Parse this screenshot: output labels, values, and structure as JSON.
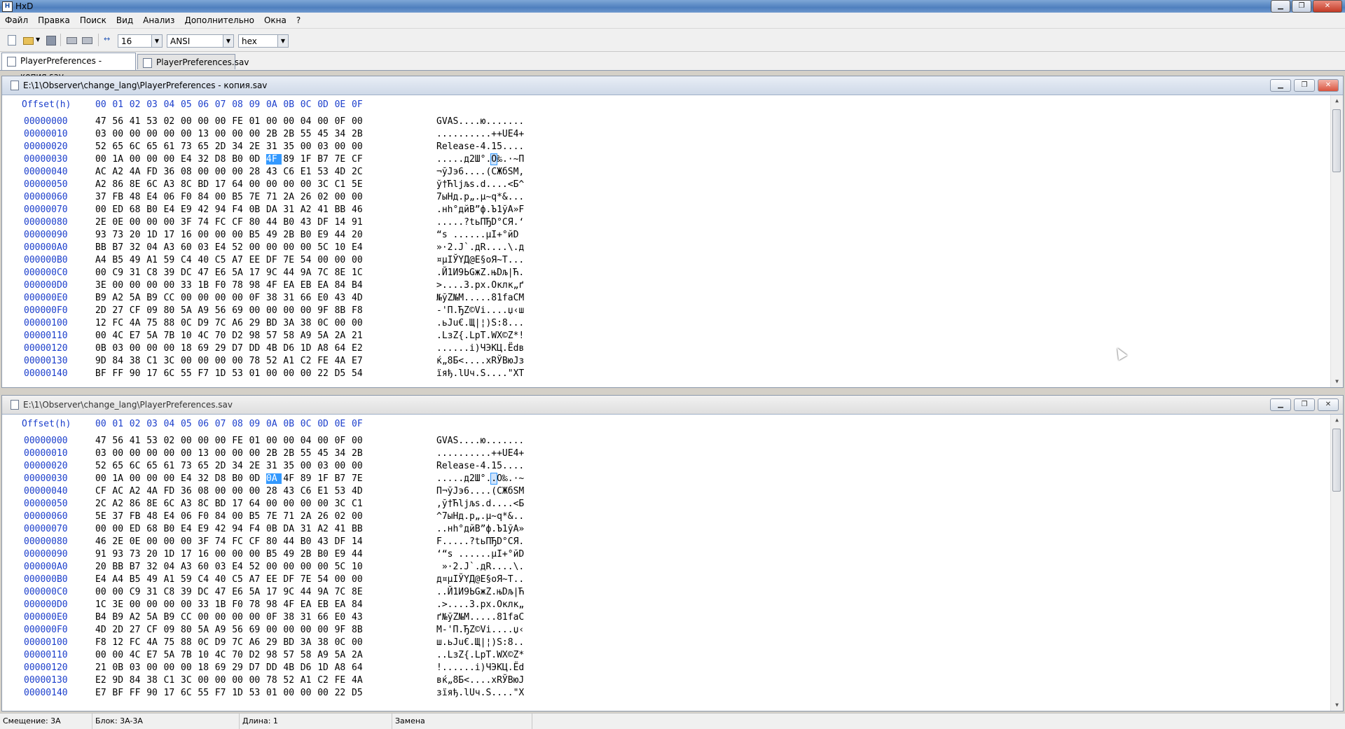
{
  "app": {
    "title": "HxD"
  },
  "menu": [
    "Файл",
    "Правка",
    "Поиск",
    "Вид",
    "Анализ",
    "Дополнительно",
    "Окна",
    "?"
  ],
  "toolbar": {
    "bytes_per_row": "16",
    "charset": "ANSI",
    "display_mode": "hex"
  },
  "tabs": [
    {
      "label": "PlayerPreferences - копия.sav",
      "active": true
    },
    {
      "label": "PlayerPreferences.sav",
      "active": false
    }
  ],
  "header": {
    "offset_label": "Offset(h)",
    "columns": [
      "00",
      "01",
      "02",
      "03",
      "04",
      "05",
      "06",
      "07",
      "08",
      "09",
      "0A",
      "0B",
      "0C",
      "0D",
      "0E",
      "0F"
    ]
  },
  "editors": [
    {
      "path": "E:\\1\\Observer\\change_lang\\PlayerPreferences - копия.sav",
      "selected": {
        "row": 3,
        "col": 10
      },
      "rows": [
        {
          "off": "00000000",
          "bytes": "47 56 41 53 02 00 00 00 FE 01 00 00 04 00 0F 00",
          "ascii": "GVAS....ю......."
        },
        {
          "off": "00000010",
          "bytes": "03 00 00 00 00 00 13 00 00 00 2B 2B 55 45 34 2B",
          "ascii": "..........++UE4+"
        },
        {
          "off": "00000020",
          "bytes": "52 65 6C 65 61 73 65 2D 34 2E 31 35 00 03 00 00",
          "ascii": "Release-4.15...."
        },
        {
          "off": "00000030",
          "bytes": "00 1A 00 00 00 E4 32 D8 B0 0D 4F 89 1F B7 7E CF",
          "ascii": ".....д2Ш°.O‰.·~П"
        },
        {
          "off": "00000040",
          "bytes": "AC A2 4A FD 36 08 00 00 00 28 43 C6 E1 53 4D 2C",
          "ascii": "¬ўJэ6....(CЖбSM,"
        },
        {
          "off": "00000050",
          "bytes": "A2 86 8E 6C A3 8C BD 17 64 00 00 00 00 3C C1 5E",
          "ascii": "ў†Ћlјљѕ.d....<Б^"
        },
        {
          "off": "00000060",
          "bytes": "37 FB 48 E4 06 F0 84 00 B5 7E 71 2A 26 02 00 00",
          "ascii": "7ыНд.р„.µ~q*&..."
        },
        {
          "off": "00000070",
          "bytes": "00 ED 68 B0 E4 E9 42 94 F4 0B DA 31 A2 41 BB 46",
          "ascii": ".нh°дйВ”ф.Ъ1ўA»F"
        },
        {
          "off": "00000080",
          "bytes": "2E 0E 00 00 00 3F 74 FC CF 80 44 B0 43 DF 14 91",
          "ascii": ".....?tьПЂD°CЯ.‘"
        },
        {
          "off": "00000090",
          "bytes": "93 73 20 1D 17 16 00 00 00 B5 49 2B B0 E9 44 20",
          "ascii": "“s ......µI+°йD "
        },
        {
          "off": "000000A0",
          "bytes": "BB B7 32 04 A3 60 03 E4 52 00 00 00 00 5C 10 E4",
          "ascii": "»·2.J`.дR....\\.д"
        },
        {
          "off": "000000B0",
          "bytes": "A4 B5 49 A1 59 C4 40 C5 A7 EE DF 7E 54 00 00 00",
          "ascii": "¤µIЎYД@Е§оЯ~T..."
        },
        {
          "off": "000000C0",
          "bytes": "00 C9 31 C8 39 DC 47 E6 5A 17 9C 44 9A 7C 8E 1C",
          "ascii": ".Й1И9ЬGжZ.њDљ|Ћ."
        },
        {
          "off": "000000D0",
          "bytes": "3E 00 00 00 00 33 1B F0 78 98 4F EA EB EA 84 B4",
          "ascii": ">....3.рх.Оклк„ґ"
        },
        {
          "off": "000000E0",
          "bytes": "B9 A2 5A B9 CC 00 00 00 00 0F 38 31 66 E0 43 4D",
          "ascii": "№ўZ№М.....81faCM"
        },
        {
          "off": "000000F0",
          "bytes": "2D 27 CF 09 80 5A A9 56 69 00 00 00 00 9F 8B F8",
          "ascii": "-'П.ЂZ©Vi....џ‹ш"
        },
        {
          "off": "00000100",
          "bytes": "12 FC 4A 75 88 0C D9 7C A6 29 BD 3A 38 0C 00 00",
          "ascii": ".ьJu€.Щ|¦)S:8..."
        },
        {
          "off": "00000110",
          "bytes": "00 4C E7 5A 7B 10 4C 70 D2 98 57 58 A9 5A 2A 21",
          "ascii": ".LзZ{.LpТ.WX©Z*!"
        },
        {
          "off": "00000120",
          "bytes": "0B 03 00 00 00 18 69 29 D7 DD 4B D6 1D A8 64 E2",
          "ascii": "......i)ЧЭКЦ.Ёdв"
        },
        {
          "off": "00000130",
          "bytes": "9D 84 38 C1 3C 00 00 00 00 78 52 A1 C2 FE 4A E7",
          "ascii": "ќ„8Б<....xRЎВюJз"
        },
        {
          "off": "00000140",
          "bytes": "BF FF 90 17 6C 55 F7 1D 53 01 00 00 00 22 D5 54",
          "ascii": "їяђ.lUч.S....\"XT"
        }
      ]
    },
    {
      "path": "E:\\1\\Observer\\change_lang\\PlayerPreferences.sav",
      "selected": {
        "row": 3,
        "col": 10
      },
      "rows": [
        {
          "off": "00000000",
          "bytes": "47 56 41 53 02 00 00 00 FE 01 00 00 04 00 0F 00",
          "ascii": "GVAS....ю......."
        },
        {
          "off": "00000010",
          "bytes": "03 00 00 00 00 00 13 00 00 00 2B 2B 55 45 34 2B",
          "ascii": "..........++UE4+"
        },
        {
          "off": "00000020",
          "bytes": "52 65 6C 65 61 73 65 2D 34 2E 31 35 00 03 00 00",
          "ascii": "Release-4.15...."
        },
        {
          "off": "00000030",
          "bytes": "00 1A 00 00 00 E4 32 D8 B0 0D 0A 4F 89 1F B7 7E",
          "ascii": ".....д2Ш°..O‰.·~"
        },
        {
          "off": "00000040",
          "bytes": "CF AC A2 4A FD 36 08 00 00 00 28 43 C6 E1 53 4D",
          "ascii": "П¬ўJэ6....(CЖбSM"
        },
        {
          "off": "00000050",
          "bytes": "2C A2 86 8E 6C A3 8C BD 17 64 00 00 00 00 3C C1",
          "ascii": ",ў†Ћlјљѕ.d....<Б"
        },
        {
          "off": "00000060",
          "bytes": "5E 37 FB 48 E4 06 F0 84 00 B5 7E 71 2A 26 02 00",
          "ascii": "^7ыНд.р„.µ~q*&.."
        },
        {
          "off": "00000070",
          "bytes": "00 00 ED 68 B0 E4 E9 42 94 F4 0B DA 31 A2 41 BB",
          "ascii": "..нh°дйВ”ф.Ъ1ўA»"
        },
        {
          "off": "00000080",
          "bytes": "46 2E 0E 00 00 00 3F 74 FC CF 80 44 B0 43 DF 14",
          "ascii": "F.....?tьПЂD°CЯ."
        },
        {
          "off": "00000090",
          "bytes": "91 93 73 20 1D 17 16 00 00 00 B5 49 2B B0 E9 44",
          "ascii": "‘“s ......µI+°йD"
        },
        {
          "off": "000000A0",
          "bytes": "20 BB B7 32 04 A3 60 03 E4 52 00 00 00 00 5C 10",
          "ascii": " »·2.J`.дR....\\."
        },
        {
          "off": "000000B0",
          "bytes": "E4 A4 B5 49 A1 59 C4 40 C5 A7 EE DF 7E 54 00 00",
          "ascii": "д¤µIЎYД@Е§оЯ~T.."
        },
        {
          "off": "000000C0",
          "bytes": "00 00 C9 31 C8 39 DC 47 E6 5A 17 9C 44 9A 7C 8E",
          "ascii": "..Й1И9ЬGжZ.њDљ|Ћ"
        },
        {
          "off": "000000D0",
          "bytes": "1C 3E 00 00 00 00 33 1B F0 78 98 4F EA EB EA 84",
          "ascii": ".>....3.рх.Оклк„"
        },
        {
          "off": "000000E0",
          "bytes": "B4 B9 A2 5A B9 CC 00 00 00 00 0F 38 31 66 E0 43",
          "ascii": "ґ№ўZ№М.....81faC"
        },
        {
          "off": "000000F0",
          "bytes": "4D 2D 27 CF 09 80 5A A9 56 69 00 00 00 00 9F 8B",
          "ascii": "M-'П.ЂZ©Vi....џ‹"
        },
        {
          "off": "00000100",
          "bytes": "F8 12 FC 4A 75 88 0C D9 7C A6 29 BD 3A 38 0C 00",
          "ascii": "ш.ьJu€.Щ|¦)S:8.."
        },
        {
          "off": "00000110",
          "bytes": "00 00 4C E7 5A 7B 10 4C 70 D2 98 57 58 A9 5A 2A",
          "ascii": "..LзZ{.LpТ.WX©Z*"
        },
        {
          "off": "00000120",
          "bytes": "21 0B 03 00 00 00 18 69 29 D7 DD 4B D6 1D A8 64",
          "ascii": "!......i)ЧЭКЦ.Ёd"
        },
        {
          "off": "00000130",
          "bytes": "E2 9D 84 38 C1 3C 00 00 00 00 78 52 A1 C2 FE 4A",
          "ascii": "вќ„8Б<....xRЎВюJ"
        },
        {
          "off": "00000140",
          "bytes": "E7 BF FF 90 17 6C 55 F7 1D 53 01 00 00 00 22 D5",
          "ascii": "зїяђ.lUч.S....\"X"
        }
      ]
    }
  ],
  "status": {
    "offset": "Смещение: 3A",
    "block": "Блок: 3A-3A",
    "length": "Длина: 1",
    "mode": "Замена"
  },
  "colors": {
    "selection": "#3399ff",
    "offset_text": "#1c3fcc"
  }
}
